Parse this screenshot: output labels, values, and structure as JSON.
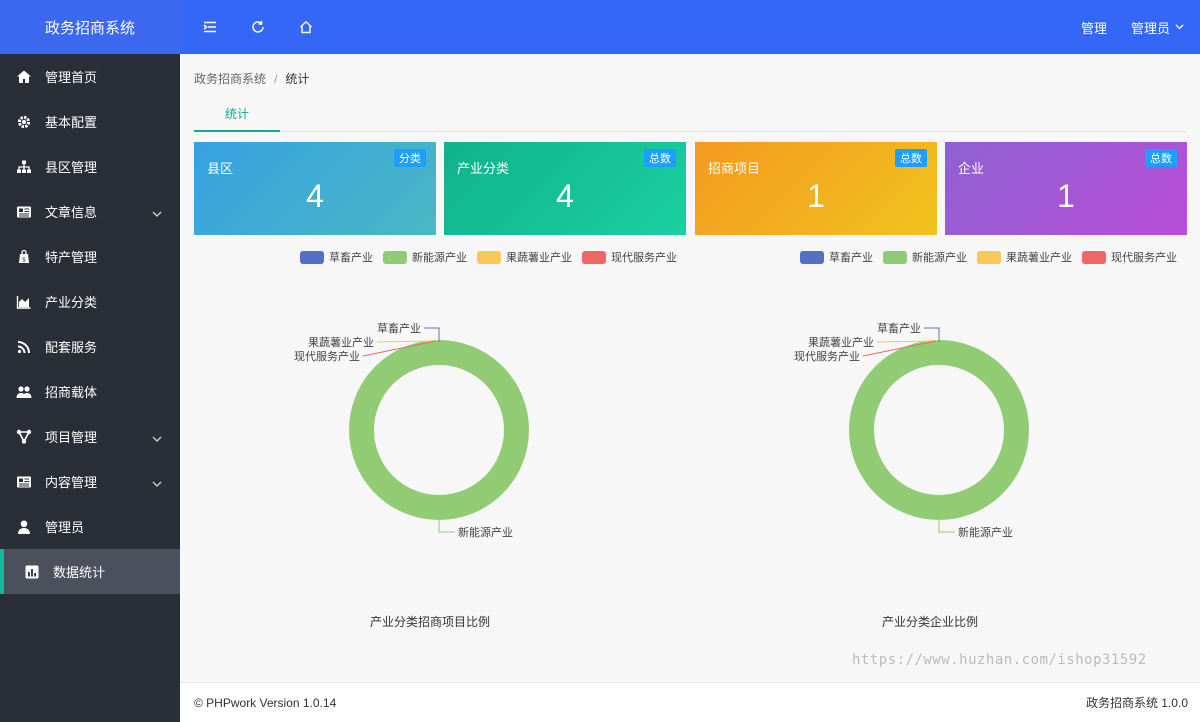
{
  "app": {
    "title": "政务招商系统"
  },
  "topbar": {
    "tools": [
      {
        "name": "menu-toggle-icon"
      },
      {
        "name": "refresh-icon"
      },
      {
        "name": "home-icon"
      }
    ],
    "manage_label": "管理",
    "user_label": "管理员"
  },
  "sidebar": {
    "items": [
      {
        "label": "管理首页",
        "icon": "home-icon",
        "has_children": false
      },
      {
        "label": "基本配置",
        "icon": "gear-icon",
        "has_children": false
      },
      {
        "label": "县区管理",
        "icon": "sitemap-icon",
        "has_children": false
      },
      {
        "label": "文章信息",
        "icon": "newspaper-icon",
        "has_children": true
      },
      {
        "label": "特产管理",
        "icon": "shopping-bag-icon",
        "has_children": false
      },
      {
        "label": "产业分类",
        "icon": "area-chart-icon",
        "has_children": false
      },
      {
        "label": "配套服务",
        "icon": "rss-icon",
        "has_children": false
      },
      {
        "label": "招商载体",
        "icon": "users-icon",
        "has_children": false
      },
      {
        "label": "项目管理",
        "icon": "network-icon",
        "has_children": true
      },
      {
        "label": "内容管理",
        "icon": "newspaper-icon",
        "has_children": true
      },
      {
        "label": "管理员",
        "icon": "user-icon",
        "has_children": false
      },
      {
        "label": "数据统计",
        "icon": "bar-chart-icon",
        "has_children": false,
        "active": true
      }
    ]
  },
  "breadcrumb": {
    "root": "政务招商系统",
    "separator": "/",
    "current": "统计"
  },
  "tabs": [
    {
      "label": "统计",
      "active": true
    }
  ],
  "cards": [
    {
      "title": "县区",
      "badge": "分类",
      "value": "4",
      "gradient": [
        "#36a1e0",
        "#4ab8c4"
      ]
    },
    {
      "title": "产业分类",
      "badge": "总数",
      "value": "4",
      "gradient": [
        "#11b28c",
        "#1ad0a0"
      ]
    },
    {
      "title": "招商项目",
      "badge": "总数",
      "value": "1",
      "gradient": [
        "#f39a22",
        "#f1c31c"
      ]
    },
    {
      "title": "企业",
      "badge": "总数",
      "value": "1",
      "gradient": [
        "#8e61d1",
        "#b84ed8"
      ]
    }
  ],
  "chart_data": [
    {
      "type": "pie",
      "variant": "donut",
      "title": "产业分类招商项目比例",
      "categories": [
        "草畜产业",
        "新能源产业",
        "果蔬薯业产业",
        "现代服务产业"
      ],
      "values": [
        0,
        1,
        0,
        0
      ],
      "colors": [
        "#5470c6",
        "#91cc75",
        "#fac858",
        "#ee6666"
      ],
      "legend": "top"
    },
    {
      "type": "pie",
      "variant": "donut",
      "title": "产业分类企业比例",
      "categories": [
        "草畜产业",
        "新能源产业",
        "果蔬薯业产业",
        "现代服务产业"
      ],
      "values": [
        0,
        1,
        0,
        0
      ],
      "colors": [
        "#5470c6",
        "#91cc75",
        "#fac858",
        "#ee6666"
      ],
      "legend": "top"
    }
  ],
  "watermark": "https://www.huzhan.com/ishop31592",
  "footer": {
    "left": "© PHPwork Version 1.0.14",
    "right": "政务招商系统 1.0.0"
  }
}
